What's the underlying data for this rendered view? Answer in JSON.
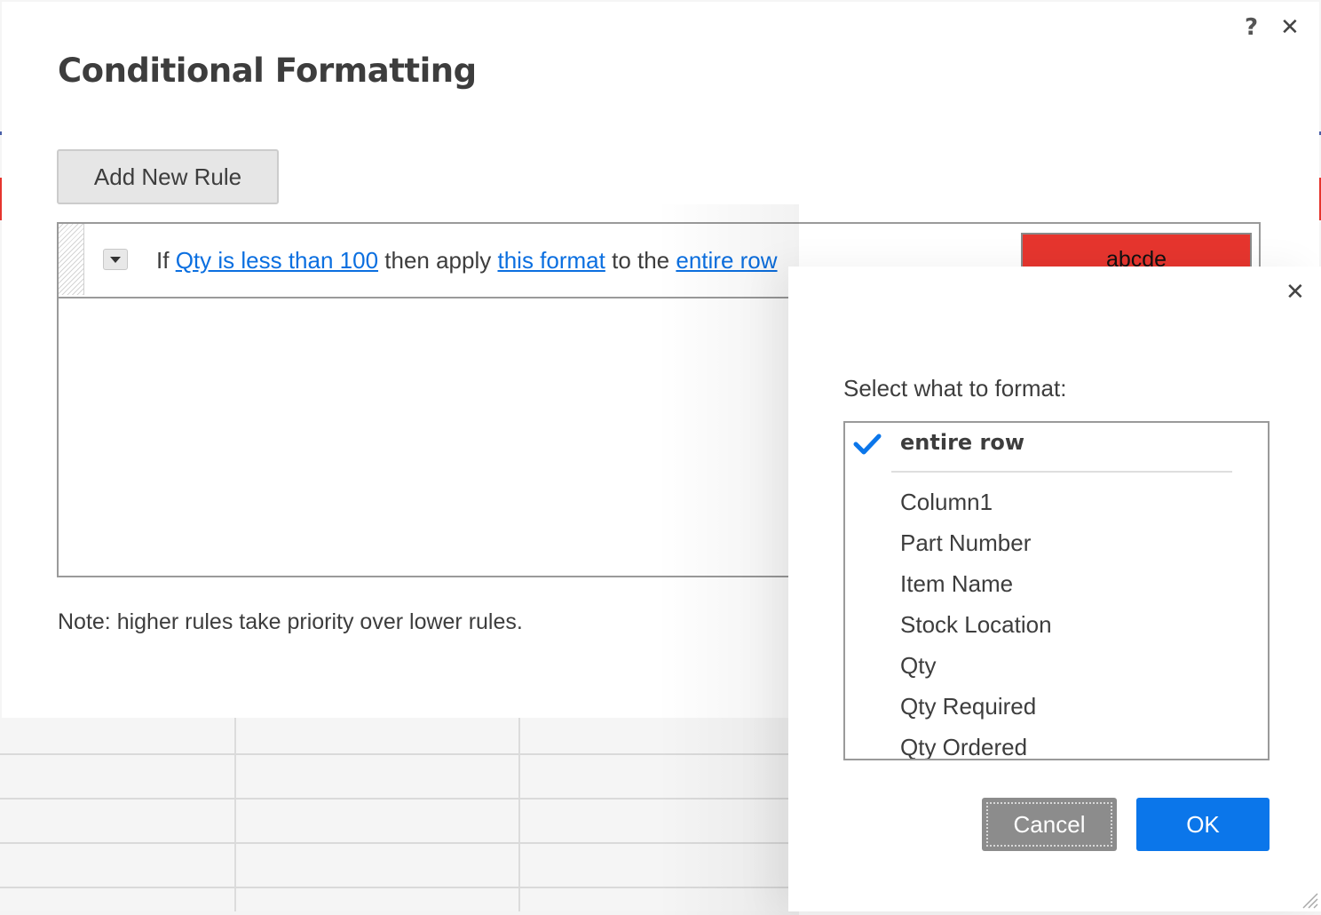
{
  "main_dialog": {
    "title": "Conditional Formatting",
    "help_icon": "?",
    "close_icon": "✕",
    "add_rule_label": "Add New Rule",
    "rules": [
      {
        "prefix": "If",
        "condition": "Qty is less than 100",
        "middle": "then apply",
        "format_link": "this format",
        "suffix": "to the",
        "target": "entire row",
        "preview_text": "abcde",
        "preview_bg": "#e6352e"
      }
    ],
    "note": "Note: higher rules take priority over lower rules."
  },
  "format_target_dialog": {
    "close_icon": "✕",
    "label": "Select what to format:",
    "selected": "entire row",
    "options": [
      "Column1",
      "Part Number",
      "Item Name",
      "Stock Location",
      "Qty",
      "Qty Required",
      "Qty Ordered"
    ],
    "cancel_label": "Cancel",
    "ok_label": "OK"
  },
  "colors": {
    "link": "#0b6fe0",
    "primary": "#0b76ea",
    "secondary_button": "#8c8c8c",
    "check": "#0b76ea"
  }
}
